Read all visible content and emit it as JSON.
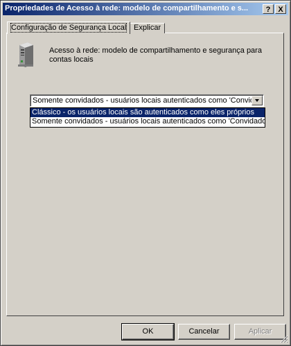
{
  "window": {
    "title": "Propriedades de Acesso à rede: modelo de compartilhamento e s...",
    "help_button": "?",
    "close_button": "X"
  },
  "tabs": [
    {
      "label": "Configuração de Segurança Local",
      "active": true
    },
    {
      "label": "Explicar",
      "active": false
    }
  ],
  "policy": {
    "icon": "server-icon",
    "description": "Acesso à rede: modelo de compartilhamento e segurança para contas locais"
  },
  "combo": {
    "value": "Somente convidados - usuários locais autenticados como 'Convidados'",
    "options": [
      {
        "label": "Clássico - os usuários locais são autenticados como eles próprios",
        "highlighted": true
      },
      {
        "label": "Somente convidados - usuários locais autenticados como 'Convidados'",
        "highlighted": false
      }
    ]
  },
  "buttons": {
    "ok": "OK",
    "cancel": "Cancelar",
    "apply": "Aplicar"
  },
  "colors": {
    "face": "#d4d0c8",
    "title_start": "#0a246a",
    "title_end": "#a6caf0",
    "highlight": "#0a246a"
  }
}
